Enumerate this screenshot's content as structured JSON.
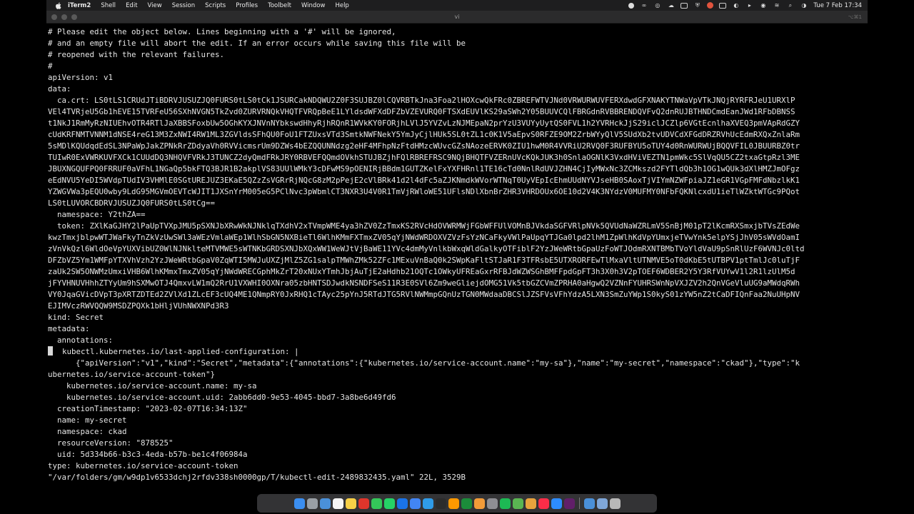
{
  "menubar": {
    "app_name": "iTerm2",
    "menus": [
      "Shell",
      "Edit",
      "View",
      "Session",
      "Scripts",
      "Profiles",
      "Toolbelt",
      "Window",
      "Help"
    ],
    "clock": "Tue 7 Feb  17:34"
  },
  "window": {
    "title": "vi",
    "shortcut": "⌥⌘1"
  },
  "editor": {
    "lines": [
      "# Please edit the object below. Lines beginning with a '#' will be ignored,",
      "# and an empty file will abort the edit. If an error occurs while saving this file will be",
      "# reopened with the relevant failures.",
      "#",
      "apiVersion: v1",
      "data:",
      "  ca.crt: LS0tLS1CRUdJTiBDRVJUSUZJQ0FURS0tLS0tCk1JSURCakNDQWU2Z0F3SUJBZ0lCQVRBTkJna3Foa2lHOXcwQkFRc0ZBREFWTVJNd0VRWURWUVFERXdwdGFXNAKYTNWaVpVTkJNQjRYRFRJeU1URXlP",
      "VEl4TVRjeU5Gb1hEVE15TVRFeU56SXhNVGN5TkZvd0ZURVRNQkVHQTFVRQpBeE1LYldsdWFXdDFZbVZEVURQ0FTSXdEUVlKS29aSWh2Y05BUUVCQlFBRGdnRVBBRENDQVFvQ2dnRUJBTHNDCmdEanJWd1RFbDBNSS",
      "t1NkJ1RmMyRzNIUEhvOTR4RTlJaXBBSFoxbUw5OGhKYXJNVnNYbkswdHhyRjhRQnR1WVkKY0FORjhLVlJ5YVZvLzNJMEpaN2prYzU3VUYyUytQS0FVL1h2YVRHckJjS29iclJCZlp6VGtEcnlhaXVEQ3pmVApRdGZY",
      "cUdKRFNMTVNNM1dNSE4reG13M3ZxNWI4RW1ML3ZGVldsSFhQU0FoU1FTZUxsVTd3SmtkNWFNekY5YmJyCjlHUk5SL0tZL1c0K1V5aEpvS0RFZE9OM2ZrbWYyQlV5SUdXb2tvUDVCdXFGdDRZRVhUcEdmRXQxZnlaRm",
      "5sMDlKQUdqdEdSL3NPaWpJakZPNkRrZDdyaVh0RVVicmsrUm9DZWs4bEZQQUNNdzg2eHF4MFhpNzFtdHMzcWUvcGZsNAozeERVK0ZIU1hwM0R4VVRiU2RVQ0F3RUFBYU5oTUY4d0RnWURWUjBQQVFIL0JBUURBZ0tr",
      "TUIwR0ExVWRKUVFXCk1CUUdDQ3NHQVFVRkJ3TUNCZ2dyQmdFRkJRY0RBVEFQQmdOVkhSTUJBZjhFQlRBREFRSC9NQjBHQTFVZERnUVcKQkJUK3h0SnlaOGNlK3VxdHViVEZTN1pmWkc5SlVqQU5CZ2txaGtpRzl3ME",
      "JBUXNGQUFPQ0FRRUF0aVFhL1NGaQp5bkFTQ3BJR1B2akplVS83UUlWMkY3cDFwMS9pOENIRjBBdm1GUTZKelFxYXFHRnl1TE16cTd0NnlRdUVJZHN4CjIyMWxNc3ZCMkszd2FYTldQb3h1OG1wQUk3dXlHMZJmOFgz",
      "eEdNVU5YeDI5WVdpTUdIV3VHMlE0SGtUREJUZ3EKaE5QZzZsVGRrRjNQcG8zM2pPejE2cVlBRk41d2l4dFc5aZJKNmdkWVorWTNqT0UyVEpIcEhmUUdNYVJseHB0SAoxTjVIYmNZWFpiaJZ1eGR1VGpFMFdNbzlkK1",
      "YZWGVWa3pEQU0wby9LdG95MGVmOEVTcWJIT1JXSnYrM005eG5PClNvc3pWbmlCT3NXR3U4V0R1TmVjRWloWE51UFlsNDlXbnBrZHR3VHRDOUx6OE10d2V4K3NYdzV0MUFMY0NFbFQKNlcxdU1ieTlWZktWTGc9PQot",
      "LS0tLUVORCBDRVJUSUZJQ0FURS0tLS0tCg==",
      "  namespace: Y2thZA==",
      "  token: ZXlKaGJHY2lPaUpTVXpJMU5pSXNJbXRwWkNJNklqTXdhV2xTVmpWME4ya3hZV0ZzTmxKS2RVcHdOVWRMWjFGbWFFUlVOMnBJVkdaSGFVRlpNVk5QVUdNaWZRLmV5SnBjM01pT2lKcmRXSmxjbTVsZEdWe",
      "kwzTmxjblpwWTJWaFkyTnZkVzUwSWl3aWEzVmlaWEp1WlhSbGN5NXBieTl6WlhKMmFXTmxZV05qYjNWdWRDOXVZVzFsYzNCaFkyVWlPaUpqYTJGa0lpd2lhM1ZpWlhKdVpYUmxjeTVwYnk5elpYSjJhV05sWVdOamI",
      "zVnVkQzl6WldOeVpYUXVibUZ0WlNJNklteMTVMWE5sWTNKbGRDSXNJbXQxWW1WeWJtVjBaWE11YVc4dmMyVnlkbWxqWldGalkyOTFiblF2YzJWeWRtbGpaUzFoWTJOdmRXNTBMbTVoYldVaU9pSnRlUzF6WVNJc0ltd",
      "DFZbVZ5Ym1WMFpYTXVhVzh2YzJWeWRtbGpaV0ZqWTI5MWJuUXZjMlZ5ZG1salpTMWhZMk52ZFc1MExuVnBaQ0k2SWpKaFltSTJaR1F3TFRsbE5UTXRORFEwTlMxaVltUTNMVE5oT0dKbE5tUTBPV1ptTmlJc0luTjF",
      "zaUk2SW5ONWMzUmxiVHB6WlhKMmxTmxZV05qYjNWdWRECGphMkZrT20xNUxYTmhJbjAuTjE2aHdhb21OQTc1OWkyUFREaGxrRFBJdWZWSGhBMFFpdGpFT3h3X0h3V2pTOEF6WDBER2Y5Y3RfVUYwV1l2R1lzUlM5d",
      "jFYVHNUVHhhZTYyUm9hSXMwOTJ4QmxvLW1mQ2RrU1VXWHI0OXNra05zbHNTSDJwdkNSNDFSeS11R3E0SVl6Zm9weGliejdOMG51Vk5tbGZCVmZPRHA0aHgwQ2VZNnFYUHRSWnNpVXJZV2h2QnVGeVluUG9aMWdqRWh",
      "VY0JqaGVicDVpT3pXRTZDTEd2ZVlXd1ZLcEF3cUQ4ME1QNmpRY0JxRHQ1cTAyc25pYnJ5RTdJTG5RVlNWMmpGQnUzTGN0MWdaaDBCSlJZSFVsVFhYdzA5LXN3SmZuYWp1S0kyS01zYW5nZ2tCaDFIQnFaa2NuUHpNV",
      "EJIMVczRWVQQW9MSDZPQXk1bHljVUhNWXNPd3R3",
      "kind: Secret",
      "metadata:",
      "  annotations:",
      "    kubectl.kubernetes.io/last-applied-configuration: |",
      "      {\"apiVersion\":\"v1\",\"kind\":\"Secret\",\"metadata\":{\"annotations\":{\"kubernetes.io/service-account.name\":\"my-sa\"},\"name\":\"my-secret\",\"namespace\":\"ckad\"},\"type\":\"k",
      "ubernetes.io/service-account-token\"}",
      "    kubernetes.io/service-account.name: my-sa",
      "    kubernetes.io/service-account.uid: 2abb6dd0-9e53-4045-bbd7-3a8be6d49fd6",
      "  creationTimestamp: \"2023-02-07T16:34:13Z\"",
      "  name: my-secret",
      "  namespace: ckad",
      "  resourceVersion: \"878525\"",
      "  uid: 5d334b66-b3c3-4eda-b57b-be1c4f06984a",
      "type: kubernetes.io/service-account-token"
    ],
    "cursor_line_prefix": "  ",
    "cursor_line_rest": "  kubectl.kubernetes.io/last-applied-configuration: |",
    "status_line": "\"/var/folders/gm/w9dp1v6533dchj2rfdv338sh0000gp/T/kubectl-edit-2489832435.yaml\" 22L, 3529B"
  },
  "dock": {
    "icons": [
      "finder-icon",
      "launchpad-icon",
      "mail-icon",
      "calendar-icon",
      "notes-icon",
      "opera-icon",
      "messages-icon",
      "whatsapp-icon",
      "onepassword-icon",
      "chrome-icon",
      "safari-icon",
      "iterm-icon",
      "sublime-icon",
      "vim-icon",
      "books-icon",
      "preferences-icon",
      "spotify-icon",
      "maps-icon",
      "photos-icon",
      "music-icon",
      "zoom-icon",
      "slack-icon",
      "downloads-icon",
      "documents-icon",
      "trash-icon"
    ],
    "colors": [
      "#3b8ef0",
      "#9aa0a6",
      "#4a90d9",
      "#f5f5f5",
      "#f7d046",
      "#e0352b",
      "#34c759",
      "#25d366",
      "#1a73e8",
      "#4285f4",
      "#2f9be8",
      "#2c2c2c",
      "#ff9800",
      "#1b8c3a",
      "#f29b38",
      "#8e8e93",
      "#1db954",
      "#5ab552",
      "#e8a33d",
      "#fa2d48",
      "#2d8cff",
      "#611f69",
      "#4a90d9",
      "#7fa7d9",
      "#b8b8b8"
    ]
  },
  "colors": {
    "terminal_background": "#000000",
    "terminal_foreground": "#e6e6e6",
    "menubar_background": "#1e1e1f",
    "titlebar_background": "#2b2b2c"
  }
}
